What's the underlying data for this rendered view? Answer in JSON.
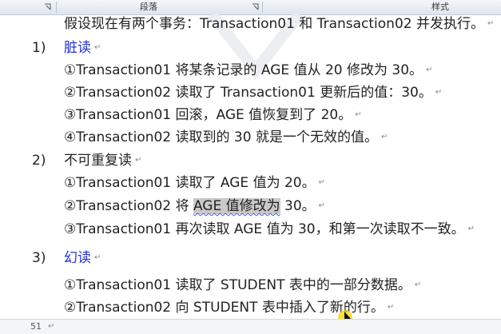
{
  "ribbon": {
    "paragraph_group": "段落",
    "styles_group": "样式"
  },
  "intro": "假设现在有两个事务：Transaction01 和 Transaction02 并发执行。",
  "mark": "↵",
  "sections": [
    {
      "number": "1)",
      "title": "脏读",
      "items": [
        "①Transaction01 将某条记录的 AGE 值从 20 修改为 30。",
        "②Transaction02 读取了 Transaction01 更新后的值：30。",
        "③Transaction01 回滚，AGE 值恢复到了 20。",
        "④Transaction02 读取到的 30 就是一个无效的值。"
      ]
    },
    {
      "number": "2)",
      "title": "不可重复读",
      "items": [
        "①Transaction01 读取了 AGE 值为 20。",
        {
          "pre": "②Transaction02 将 ",
          "highlight": "AGE 值修改为",
          "post": " 30。"
        },
        "③Transaction01 再次读取 AGE 值为 30，和第一次读取不一致。"
      ]
    },
    {
      "number": "3)",
      "title": "幻读",
      "items": [
        "①Transaction01 读取了 STUDENT 表中的一部分数据。",
        "②Transaction02 向 STUDENT 表中插入了新的行。"
      ]
    }
  ],
  "status": {
    "line_number": "51"
  },
  "colors": {
    "heading_blue": "#2233c9",
    "highlight": "#c9c9c9",
    "cursor": "#f0d400"
  }
}
